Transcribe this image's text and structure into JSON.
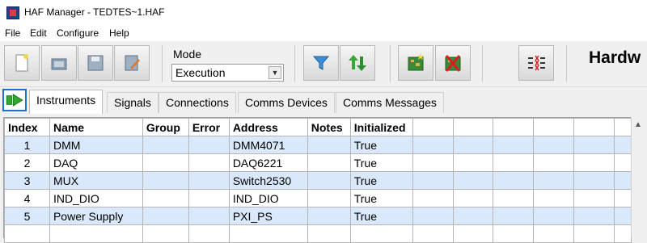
{
  "window": {
    "title": "HAF Manager - TEDTES~1.HAF"
  },
  "menu": [
    "File",
    "Edit",
    "Configure",
    "Help"
  ],
  "toolbar": {
    "mode_label": "Mode",
    "mode_value": "Execution",
    "heading": "Hardw"
  },
  "tabs": [
    "Instruments",
    "Signals",
    "Connections",
    "Comms Devices",
    "Comms Messages"
  ],
  "active_tab": "Instruments",
  "table": {
    "columns": [
      "Index",
      "Name",
      "Group",
      "Error",
      "Address",
      "Notes",
      "Initialized"
    ],
    "rows": [
      [
        "1",
        "DMM",
        "",
        "",
        "DMM4071",
        "",
        "True"
      ],
      [
        "2",
        "DAQ",
        "",
        "",
        "DAQ6221",
        "",
        "True"
      ],
      [
        "3",
        "MUX",
        "",
        "",
        "Switch2530",
        "",
        "True"
      ],
      [
        "4",
        "IND_DIO",
        "",
        "",
        "IND_DIO",
        "",
        "True"
      ],
      [
        "5",
        "Power Supply",
        "",
        "",
        "PXI_PS",
        "",
        "True"
      ],
      [
        "",
        "",
        "",
        "",
        "",
        "",
        ""
      ]
    ]
  },
  "colors": {
    "row_alt": "#d9e9fb",
    "run_border": "#1f6fd0",
    "accent_green": "#2fa830"
  }
}
